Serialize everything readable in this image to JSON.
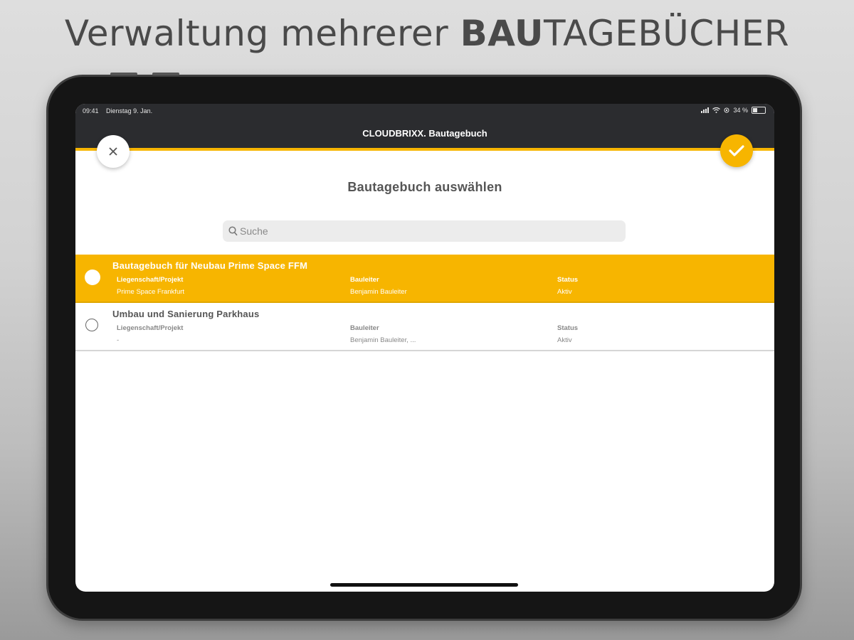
{
  "headline": {
    "regular": "Verwaltung mehrerer ",
    "bold": "BAU",
    "rest": "TAGEBÜCHER"
  },
  "status_bar": {
    "time": "09:41",
    "date": "Dienstag 9. Jan.",
    "battery": "34 %"
  },
  "nav": {
    "title": "CLOUDBRIXX. Bautagebuch",
    "close_icon": "close-icon",
    "confirm_icon": "checkmark-icon"
  },
  "page": {
    "title": "Bautagebuch auswählen"
  },
  "search": {
    "placeholder": "Suche",
    "value": ""
  },
  "columns": {
    "project": "Liegenschaft/Projekt",
    "manager": "Bauleiter",
    "status": "Status"
  },
  "diaries": [
    {
      "title": "Bautagebuch für Neubau Prime Space FFM",
      "project": "Prime Space Frankfurt",
      "manager": "Benjamin Bauleiter",
      "status": "Aktiv",
      "selected": true
    },
    {
      "title": "Umbau und Sanierung Parkhaus",
      "project": "-",
      "manager": "Benjamin Bauleiter, ...",
      "status": "Aktiv",
      "selected": false
    }
  ],
  "colors": {
    "accent": "#f7b500",
    "navbar": "#2b2c2f"
  }
}
